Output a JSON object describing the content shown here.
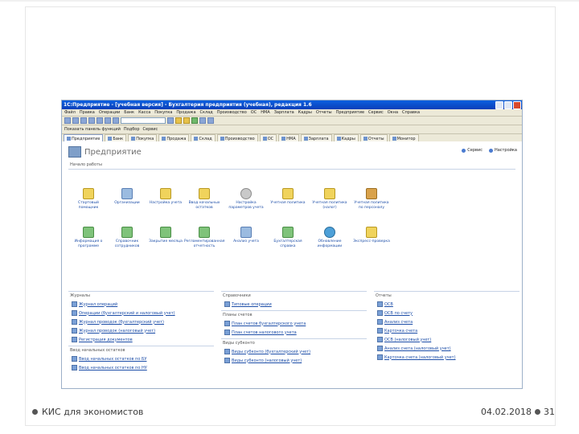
{
  "window": {
    "title": "1С:Предприятие - [учебная версия] - Бухгалтерия предприятия (учебная), редакция 1.6"
  },
  "menubar": [
    "Файл",
    "Правка",
    "Операции",
    "Банк",
    "Касса",
    "Покупка",
    "Продажа",
    "Склад",
    "Производство",
    "ОС",
    "НМА",
    "Зарплата",
    "Кадры",
    "Отчеты",
    "Предприятие",
    "Сервис",
    "Окна",
    "Справка"
  ],
  "toolbar2": [
    "Показать панель функций",
    "Подбор",
    "Сервис"
  ],
  "panel_tabs": [
    "Предприятие",
    "Банк",
    "Покупка",
    "Продажа",
    "Склад",
    "Производство",
    "ОС",
    "НМА",
    "Зарплата",
    "Кадры",
    "Отчеты",
    "Монитор"
  ],
  "heading": {
    "title": "Предприятие",
    "links": [
      "Сервис",
      "Настройка"
    ]
  },
  "sections": {
    "quick_actions": "Начало работы",
    "journals": "Журналы",
    "catalogs": "Справочники",
    "reports": "Отчеты"
  },
  "actions": [
    {
      "label": "Стартовый помощник",
      "icon": "star"
    },
    {
      "label": "Организации",
      "icon": "doc"
    },
    {
      "label": "Настройка учета",
      "icon": "star"
    },
    {
      "label": "Ввод начальных остатков",
      "icon": "star"
    },
    {
      "label": "Настройка параметров учета",
      "icon": "gear"
    },
    {
      "label": "Учетная политика",
      "icon": "star"
    },
    {
      "label": "Учетная политика (налог)",
      "icon": "star"
    },
    {
      "label": "Учетная политика по персоналу",
      "icon": "people"
    },
    {
      "label": "Информация о программе",
      "icon": "green"
    },
    {
      "label": "Справочник сотрудников",
      "icon": "green"
    },
    {
      "label": "Закрытие месяца",
      "icon": "green"
    },
    {
      "label": "Регламентированная отчетность",
      "icon": "green"
    },
    {
      "label": "Анализ учета",
      "icon": "doc"
    },
    {
      "label": "Бухгалтерская справка",
      "icon": "green"
    },
    {
      "label": "Обновление информации",
      "icon": "globe"
    },
    {
      "label": "Экспресс-проверка",
      "icon": "star"
    }
  ],
  "journals": {
    "items": [
      "Журнал операций",
      "Операции (бухгалтерский и налоговый учет)",
      "Журнал проводок (бухгалтерский учет)",
      "Журнал проводок (налоговый учет)",
      "Регистрация документов"
    ],
    "group_title": "Ввод начальных остатков",
    "group_items": [
      "Ввод начальных остатков по БУ",
      "Ввод начальных остатков по НУ"
    ]
  },
  "catalogs": {
    "items": [
      "Типовые операции"
    ],
    "group1_title": "Планы счетов",
    "group1_items": [
      "План счетов бухгалтерского учета",
      "План счетов налогового учета"
    ],
    "group2_title": "Виды субконто",
    "group2_items": [
      "Виды субконто (бухгалтерский учет)",
      "Виды субконто (налоговый учет)"
    ]
  },
  "reports": {
    "items": [
      "ОСВ",
      "ОСВ по счету",
      "Анализ счета",
      "Карточка счета",
      "ОСВ (налоговый учет)",
      "Анализ счета (налоговый учет)",
      "Карточка счета (налоговый учет)"
    ]
  },
  "footer": {
    "left": "КИС для экономистов",
    "date": "04.02.2018",
    "page": "31"
  }
}
